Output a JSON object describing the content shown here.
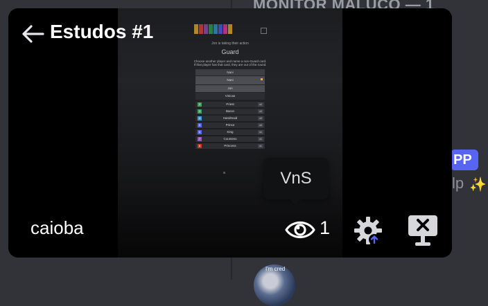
{
  "background": {
    "channel_title": "MONITOR MALUCO — 1",
    "badge_text": "PP",
    "help_text": "lp",
    "sparkle_icon": "sparkles-icon",
    "avatar_caption": "I'm cred"
  },
  "stream": {
    "title": "Estudos #1",
    "streamer_name": "caioba",
    "viewer_count": "1",
    "viewer_tooltip": "VnS",
    "icons": {
      "back": "arrow-left-icon",
      "eye": "eye-icon",
      "settings": "gear-icon",
      "stop": "stop-stream-icon"
    },
    "colors": {
      "accent": "#5865f2",
      "tooltip_bg": "#111214",
      "panel_bg": "#000000"
    }
  },
  "game": {
    "header": "Jon is taking their action",
    "card_name": "Guard",
    "instructions": "Choose another player and name a non-Guard card. If that player has that card, they are out of the round.",
    "players_header": "Nani",
    "players": [
      {
        "name": "Nani",
        "selected": true
      },
      {
        "name": "Jon",
        "selected": true
      },
      {
        "name": "Vinicas",
        "selected": false
      }
    ],
    "cards": [
      {
        "num": "2",
        "name": "Priest",
        "count": "x2",
        "color": "#3ba55d"
      },
      {
        "num": "3",
        "name": "Baron",
        "count": "x2",
        "color": "#3ba55d"
      },
      {
        "num": "4",
        "name": "Handmaid",
        "count": "x2",
        "color": "#3a9bd8"
      },
      {
        "num": "5",
        "name": "Prince",
        "count": "x2",
        "color": "#5865f2"
      },
      {
        "num": "6",
        "name": "King",
        "count": "x1",
        "color": "#5865f2"
      },
      {
        "num": "7",
        "name": "Countess",
        "count": "x1",
        "color": "#9b59b6"
      },
      {
        "num": "8",
        "name": "Princess",
        "count": "x1",
        "color": "#c0392b"
      }
    ],
    "card_strip_colors": [
      "#f0b232",
      "#e74c3c",
      "#9b59b6",
      "#3ba55d",
      "#3a9bd8",
      "#5865f2",
      "#eb459e",
      "#f0b232"
    ]
  }
}
